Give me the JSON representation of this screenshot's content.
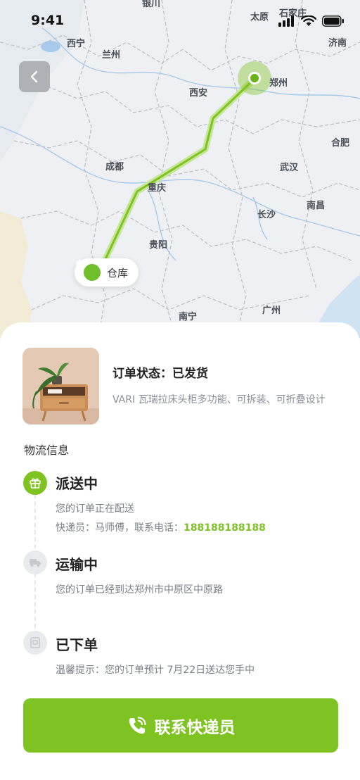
{
  "status_bar": {
    "time": "9:41"
  },
  "map": {
    "cities": [
      {
        "id": "yinchuan-partial",
        "name": "银川"
      },
      {
        "id": "taiyuan",
        "name": "太原"
      },
      {
        "id": "shijiazhuang",
        "name": "石家庄"
      },
      {
        "id": "xining",
        "name": "西宁"
      },
      {
        "id": "lanzhou",
        "name": "兰州"
      },
      {
        "id": "jinan",
        "name": "济南"
      },
      {
        "id": "zhengzhou",
        "name": "郑州"
      },
      {
        "id": "xian",
        "name": "西安"
      },
      {
        "id": "hefei",
        "name": "合肥"
      },
      {
        "id": "chengdu",
        "name": "成都"
      },
      {
        "id": "wuhan",
        "name": "武汉"
      },
      {
        "id": "chongqing",
        "name": "重庆"
      },
      {
        "id": "changsha",
        "name": "长沙"
      },
      {
        "id": "nanchang",
        "name": "南昌"
      },
      {
        "id": "guiyang",
        "name": "贵阳"
      },
      {
        "id": "nanning",
        "name": "南宁"
      },
      {
        "id": "guangzhou",
        "name": "广州"
      }
    ],
    "warehouse_label": "仓库",
    "accent_color": "#7ec321"
  },
  "order": {
    "status_text": "订单状态：已发货",
    "product_name": "VARI 瓦瑞拉床头柜多功能、可拆装、可折叠设计"
  },
  "logistics": {
    "title": "物流信息",
    "steps": [
      {
        "title": "派送中",
        "icon": "gift-icon",
        "line1": "您的订单正在配送",
        "line2_prefix": "快递员：马师傅，联系电话：",
        "phone": "188188188188"
      },
      {
        "title": "运输中",
        "icon": "truck-icon",
        "line1": "您的订单已经到达郑州市中原区中原路"
      },
      {
        "title": "已下单",
        "icon": "order-icon",
        "line1": "温馨提示：您的订单预计 7月22日送达您手中"
      }
    ]
  },
  "contact_button": {
    "label": "联系快递员",
    "icon": "phone-icon"
  }
}
